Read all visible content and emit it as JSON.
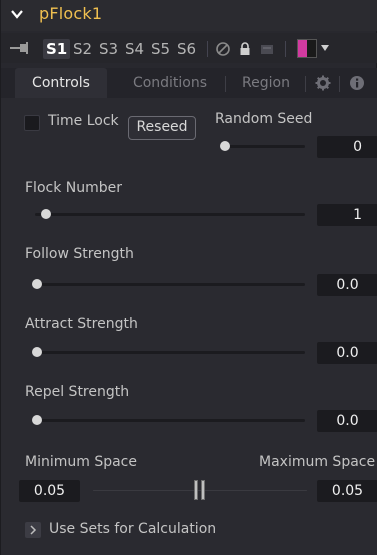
{
  "header": {
    "title": "pFlock1"
  },
  "version_bar": {
    "tabs": [
      "S1",
      "S2",
      "S3",
      "S4",
      "S5",
      "S6"
    ],
    "active": "S1",
    "swatch_color": "#d23aa0"
  },
  "tabs": {
    "items": [
      "Controls",
      "Conditions",
      "Region"
    ],
    "active": "Controls"
  },
  "controls": {
    "time_lock": {
      "label": "Time Lock",
      "checked": false
    },
    "reseed_label": "Reseed",
    "random_seed": {
      "label": "Random Seed",
      "value": "0"
    },
    "flock_number": {
      "label": "Flock Number",
      "value": "1"
    },
    "follow_strength": {
      "label": "Follow Strength",
      "value": "0.0"
    },
    "attract_strength": {
      "label": "Attract Strength",
      "value": "0.0"
    },
    "repel_strength": {
      "label": "Repel Strength",
      "value": "0.0"
    },
    "minimum_space": {
      "label": "Minimum Space",
      "value": "0.05"
    },
    "maximum_space": {
      "label": "Maximum Space",
      "value": "0.05"
    },
    "use_sets": {
      "label": "Use Sets for Calculation"
    }
  },
  "colors": {
    "title": "#f0c050",
    "accent": "#d23aa0",
    "background": "#2a2a30"
  }
}
